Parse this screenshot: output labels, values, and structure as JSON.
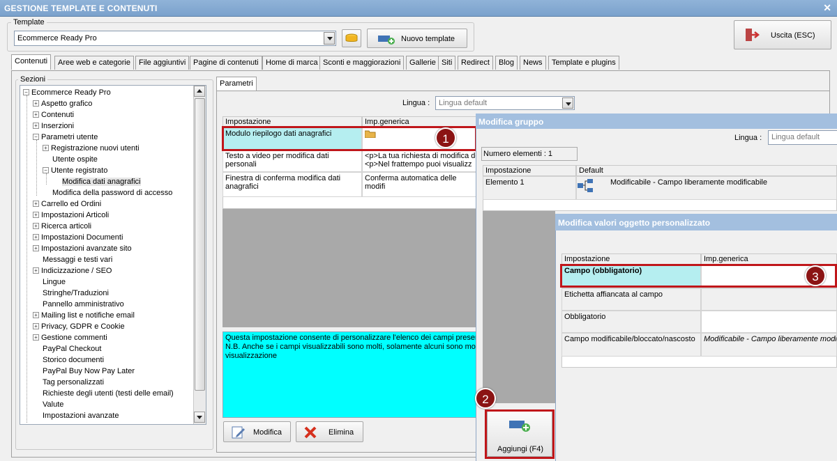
{
  "window": {
    "title": "GESTIONE TEMPLATE E CONTENUTI",
    "close": "✕"
  },
  "template": {
    "group_label": "Template",
    "selected": "Ecommerce Ready Pro",
    "new_button": "Nuovo template",
    "exit_button": "Uscita (ESC)"
  },
  "tabs": [
    "Contenuti",
    "Aree web e categorie",
    "File aggiuntivi",
    "Pagine di contenuti",
    "Home di marca",
    "Sconti e maggiorazioni",
    "Gallerie",
    "Siti",
    "Redirect",
    "Blog",
    "News",
    "Template e plugins"
  ],
  "sections": {
    "label": "Sezioni",
    "tree": [
      {
        "label": "Ecommerce Ready Pro",
        "sign": "−"
      },
      {
        "label": "Aspetto grafico",
        "sign": "+"
      },
      {
        "label": "Contenuti",
        "sign": "+"
      },
      {
        "label": "Inserzioni",
        "sign": "+"
      },
      {
        "label": "Parametri utente",
        "sign": "−"
      },
      {
        "label": "Registrazione nuovi utenti",
        "sign": "+"
      },
      {
        "label": "Utente ospite",
        "sign": ""
      },
      {
        "label": "Utente registrato",
        "sign": "−"
      },
      {
        "label": "Modifica dati anagrafici",
        "sign": ""
      },
      {
        "label": "Modifica della password di accesso",
        "sign": ""
      },
      {
        "label": "Carrello ed Ordini",
        "sign": "+"
      },
      {
        "label": "Impostazioni Articoli",
        "sign": "+"
      },
      {
        "label": "Ricerca articoli",
        "sign": "+"
      },
      {
        "label": "Impostazioni Documenti",
        "sign": "+"
      },
      {
        "label": "Impostazioni avanzate sito",
        "sign": "+"
      },
      {
        "label": "Messaggi e testi vari",
        "sign": ""
      },
      {
        "label": "Indicizzazione / SEO",
        "sign": "+"
      },
      {
        "label": "Lingue",
        "sign": ""
      },
      {
        "label": "Stringhe/Traduzioni",
        "sign": ""
      },
      {
        "label": "Pannello amministrativo",
        "sign": ""
      },
      {
        "label": "Mailing list e notifiche email",
        "sign": "+"
      },
      {
        "label": "Privacy, GDPR e Cookie",
        "sign": "+"
      },
      {
        "label": "Gestione commenti",
        "sign": "+"
      },
      {
        "label": "PayPal Checkout",
        "sign": ""
      },
      {
        "label": "Storico documenti",
        "sign": ""
      },
      {
        "label": "PayPal Buy Now Pay Later",
        "sign": ""
      },
      {
        "label": "Tag personalizzati",
        "sign": ""
      },
      {
        "label": "Richieste degli utenti (testi delle email)",
        "sign": ""
      },
      {
        "label": "Valute",
        "sign": ""
      },
      {
        "label": "Impostazioni avanzate",
        "sign": ""
      }
    ]
  },
  "params": {
    "tab": "Parametri",
    "lingua_label": "Lingua :",
    "lingua_value": "Lingua default",
    "col1": "Impostazione",
    "col2": "Imp.generica",
    "rows": [
      {
        "name": "Modulo riepilogo dati anagrafici",
        "value": ""
      },
      {
        "name": "Testo a video per modifica dati personali",
        "value": "<p>La tua richiesta di modifica de\n<p>Nel frattempo puoi visualizz"
      },
      {
        "name": "Finestra di conferma modifica dati anagrafici",
        "value": "Conferma automatica delle modifi"
      }
    ],
    "description": "Questa impostazione consente di personalizzare l'elenco dei campi presenti\nN.B. Anche se i campi visualizzabili sono molti, solamente alcuni sono modific\nvisualizzazione",
    "edit_button": "Modifica",
    "delete_button": "Elimina"
  },
  "group_dialog": {
    "title": "Modifica gruppo",
    "lingua_label": "Lingua :",
    "lingua_value": "Lingua default",
    "count": "Numero elementi : 1",
    "col1": "Impostazione",
    "col2": "Default",
    "row_name": "Elemento 1",
    "row_value": "Modificabile - Campo liberamente modificabile",
    "add_button": "Aggiungi (F4)"
  },
  "custom_dialog": {
    "title": "Modifica valori oggetto personalizzato",
    "col1": "Impostazione",
    "col2": "Imp.generica",
    "rows": [
      {
        "name": "Campo (obbligatorio)",
        "value": ""
      },
      {
        "name": "Etichetta affiancata al campo",
        "value": ""
      },
      {
        "name": "Obbligatorio",
        "value": ""
      },
      {
        "name": "Campo modificabile/bloccato/nascosto",
        "value": "Modificabile - Campo liberamente modific"
      }
    ]
  },
  "badges": [
    "1",
    "2",
    "3"
  ],
  "colors": {
    "title_bar": "#7aa1cc",
    "highlight": "#b5eef0",
    "cyan_box": "#00ffff",
    "callout_red": "#c0161a",
    "badge": "#8b1414"
  }
}
